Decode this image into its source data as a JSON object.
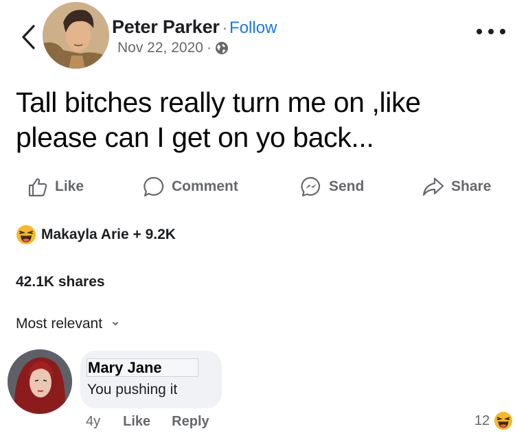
{
  "post": {
    "author": "Peter Parker",
    "follow_label": "Follow",
    "date": "Nov 22, 2020",
    "audience_icon": "globe-icon",
    "text_line1": "Tall bitches  really turn me on ,like",
    "text_line2": "please can I get on yo back..."
  },
  "actions": {
    "like": "Like",
    "comment": "Comment",
    "send": "Send",
    "share": "Share"
  },
  "reactions": {
    "emoji": "haha-icon",
    "summary": "Makayla Arie + 9.2K"
  },
  "shares": "42.1K shares",
  "comments_sort": "Most relevant",
  "comment": {
    "author": "Mary Jane",
    "text": "You pushing it",
    "time": "4y",
    "like_label": "Like",
    "reply_label": "Reply",
    "reaction_count": "12",
    "reaction_emoji": "haha-icon"
  },
  "colors": {
    "link_blue": "#1877f2",
    "secondary_text": "#65676b",
    "comment_bubble": "#f0f2f5",
    "haha_yellow": "#f7b928"
  }
}
